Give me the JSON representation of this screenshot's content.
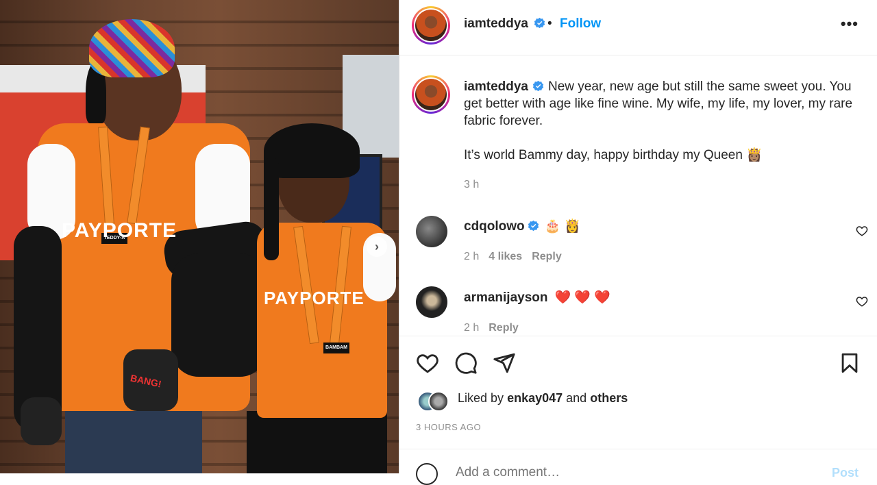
{
  "photo": {
    "brand_text": "PAYPORTE",
    "badge_left": "TEDDY-A",
    "badge_right": "BAMBAM",
    "glove_text": "BANG!",
    "next_arrow": "next-arrow-icon"
  },
  "header": {
    "username": "iamteddya",
    "verified_icon": "verified-badge-icon",
    "separator": "•",
    "follow_label": "Follow",
    "more_icon": "more-options-icon",
    "more_label": "•••"
  },
  "caption": {
    "username": "iamteddya",
    "text_line1": "New year, new age but still the same sweet you. You get better with age like fine wine. My wife, my life, my lover, my rare fabric forever.",
    "text_line2": "It’s world Bammy day, happy birthday my Queen 👸🏽",
    "time": "3 h"
  },
  "comments": [
    {
      "username": "cdqolowo",
      "verified": true,
      "text": "🎂 👸",
      "time": "2 h",
      "likes": "4 likes",
      "reply": "Reply"
    },
    {
      "username": "armanijayson",
      "verified": false,
      "text": "❤️ ❤️ ❤️",
      "time": "2 h",
      "reply": "Reply"
    }
  ],
  "actions": {
    "like_icon": "heart-icon",
    "comment_icon": "comment-icon",
    "share_icon": "send-icon",
    "save_icon": "bookmark-icon",
    "liked_by_prefix": "Liked by",
    "liked_by_user": "enkay047",
    "liked_by_and": "and",
    "liked_by_others": "others",
    "posted_ago": "3 HOURS AGO"
  },
  "add_comment": {
    "emoji_icon": "emoji-icon",
    "placeholder": "Add a comment…",
    "post_label": "Post"
  },
  "colors": {
    "link_blue": "#0095f6",
    "post_disabled": "#b2dffc",
    "heart_red": "#ed4956",
    "muted": "#8e8e8e"
  }
}
